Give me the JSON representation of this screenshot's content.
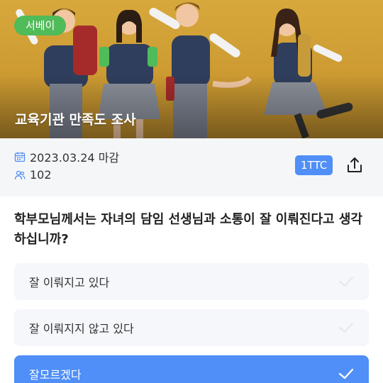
{
  "survey": {
    "category_badge": "서베이",
    "title": "교육기관 만족도 조사",
    "deadline": "2023.03.24 마감",
    "participants": "102",
    "tag": "1TTC"
  },
  "question": {
    "text": "학부모님께서는 자녀의 담임 선생님과 소통이 잘 이뤄진다고 생각하십니까?"
  },
  "options": [
    {
      "label": "잘 이뤄지고 있다",
      "selected": false
    },
    {
      "label": "잘 이뤄지지 않고 있다",
      "selected": false
    },
    {
      "label": "잘모르겠다",
      "selected": true
    }
  ],
  "colors": {
    "accent": "#4f8ff7",
    "badge": "#4fbb59",
    "banner_bg": "#d7a83c",
    "option_bg": "#f5f7fa"
  },
  "icons": {
    "calendar": "calendar-icon",
    "participants": "people-icon",
    "share": "share-icon",
    "check": "check-icon"
  }
}
